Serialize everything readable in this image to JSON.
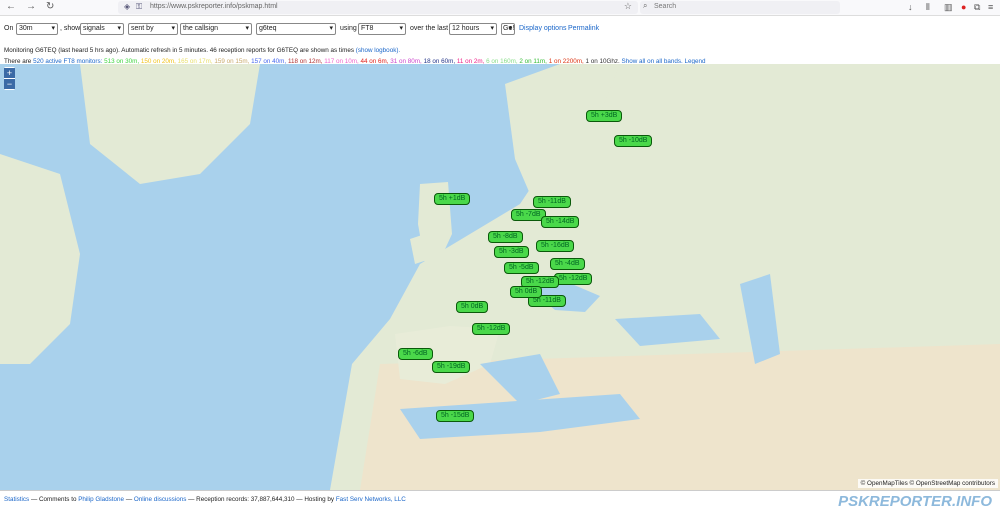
{
  "browser": {
    "url": "https://www.pskreporter.info/pskmap.html",
    "search_placeholder": "Search"
  },
  "controls": {
    "on_label": "On",
    "band": "30m",
    "show_label": ", show",
    "show_value": "signals",
    "sent_by": "sent by",
    "callsign_field": "the callsign",
    "callsign": "g6teq",
    "using_label": "using",
    "mode": "FT8",
    "over_label": "over the last",
    "period": "12 hours",
    "go": "Go!",
    "display_options": "Display options",
    "permalink": "Permalink"
  },
  "monitoring": {
    "text": "Monitoring G6TEQ (last heard 5 hrs ago). Automatic refresh in 5 minutes. 46 reception reports for G6TEQ are shown as times",
    "logbook": "(show logbook)."
  },
  "stats": {
    "prefix": "There are",
    "active": "520 active FT8 monitors:",
    "bands": [
      {
        "t": "513 on 30m,",
        "c": "#3ed43e"
      },
      {
        "t": "150 on 20m,",
        "c": "#f1c21a"
      },
      {
        "t": "165 on 17m,",
        "c": "#e8df6a"
      },
      {
        "t": "159 on 15m,",
        "c": "#c8a86a"
      },
      {
        "t": "157 on 40m,",
        "c": "#4466ee"
      },
      {
        "t": "118 on 12m,",
        "c": "#b03030"
      },
      {
        "t": "117 on 10m,",
        "c": "#ee66cc"
      },
      {
        "t": "44 on 6m,",
        "c": "#e0201a"
      },
      {
        "t": "31 on 80m,",
        "c": "#cc44cc"
      },
      {
        "t": "18 on 60m,",
        "c": "#223388"
      },
      {
        "t": "11 on 2m,",
        "c": "#ee2288"
      },
      {
        "t": "6 on 160m,",
        "c": "#88dd88"
      },
      {
        "t": "2 on 11m,",
        "c": "#33bb33"
      },
      {
        "t": "1 on 2200m,",
        "c": "#dd3311"
      },
      {
        "t": "1 on 10Ghz.",
        "c": "#333333"
      }
    ],
    "show_all": "Show all on all bands.",
    "legend": "Legend"
  },
  "map": {
    "zoom_in": "+",
    "zoom_out": "−",
    "attribution": "© OpenMapTiles © OpenStreetMap contributors",
    "labels": [
      "5h +3dB",
      "5h -10dB",
      "5h +1dB",
      "5h -11dB",
      "5h -7dB",
      "5h -14dB",
      "5h -8dB",
      "5h -16dB",
      "5h -3dB",
      "5h -12dB",
      "5h -4dB",
      "5h -5dB",
      "5h -12dB",
      "5h 0dB",
      "5h -11dB",
      "5h 0dB",
      "5h -12dB",
      "5h -6dB",
      "5h -19dB",
      "5h -15dB"
    ]
  },
  "footer": {
    "statistics": "Statistics",
    "comments": "— Comments to",
    "author": "Philip Gladstone",
    "dash1": "—",
    "discussions": "Online discussions",
    "records": "— Reception records: 37,887,644,310 — Hosting by",
    "host": "Fast Serv Networks, LLC",
    "logo": "PSKREPORTER.INFO"
  }
}
